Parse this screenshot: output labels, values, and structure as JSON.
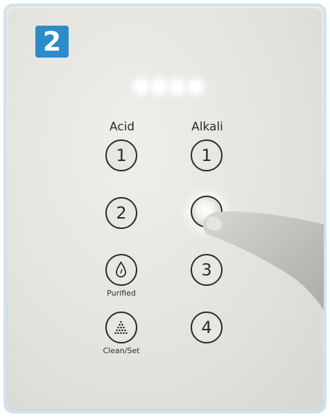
{
  "step": "2",
  "columns": {
    "acid_label": "Acid",
    "alkali_label": "Alkali"
  },
  "acid_buttons": [
    "1",
    "2"
  ],
  "alkali_buttons": [
    "1",
    "2",
    "3",
    "4"
  ],
  "mode_labels": {
    "purified": "Purified",
    "clean_set": "Clean/Set"
  },
  "indicator_count": 4,
  "active_button": "alkali-2",
  "icons": {
    "purified": "water-drop-icon",
    "clean_set": "dots-triangle-icon"
  },
  "colors": {
    "badge": "#2d8bc9",
    "frame_border": "#cfe3f1"
  }
}
